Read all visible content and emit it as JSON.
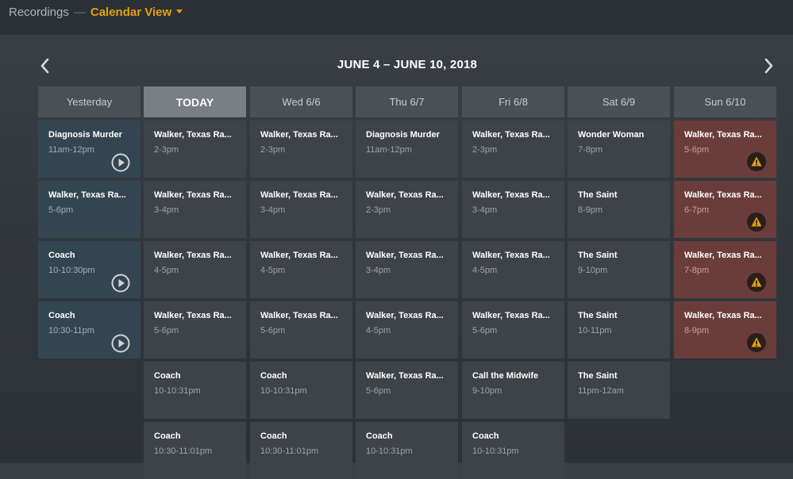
{
  "header": {
    "section": "Recordings",
    "separator": "—",
    "view": "Calendar View"
  },
  "calendar": {
    "range": "JUNE 4 – JUNE 10, 2018",
    "days": [
      {
        "label": "Yesterday",
        "today": false,
        "items": [
          {
            "title": "Diagnosis Murder",
            "time": "11am-12pm",
            "status": "watched",
            "icon": "play-icon"
          },
          {
            "title": "Walker, Texas Ra...",
            "time": "5-6pm",
            "status": "watched",
            "icon": ""
          },
          {
            "title": "Coach",
            "time": "10-10:30pm",
            "status": "watched",
            "icon": "play-icon"
          },
          {
            "title": "Coach",
            "time": "10:30-11pm",
            "status": "watched",
            "icon": "play-icon"
          }
        ]
      },
      {
        "label": "TODAY",
        "today": true,
        "items": [
          {
            "title": "Walker, Texas Ra...",
            "time": "2-3pm",
            "status": "scheduled",
            "icon": ""
          },
          {
            "title": "Walker, Texas Ra...",
            "time": "3-4pm",
            "status": "scheduled",
            "icon": ""
          },
          {
            "title": "Walker, Texas Ra...",
            "time": "4-5pm",
            "status": "scheduled",
            "icon": ""
          },
          {
            "title": "Walker, Texas Ra...",
            "time": "5-6pm",
            "status": "scheduled",
            "icon": ""
          },
          {
            "title": "Coach",
            "time": "10-10:31pm",
            "status": "scheduled",
            "icon": ""
          },
          {
            "title": "Coach",
            "time": "10:30-11:01pm",
            "status": "scheduled",
            "icon": ""
          }
        ]
      },
      {
        "label": "Wed 6/6",
        "today": false,
        "items": [
          {
            "title": "Walker, Texas Ra...",
            "time": "2-3pm",
            "status": "scheduled",
            "icon": ""
          },
          {
            "title": "Walker, Texas Ra...",
            "time": "3-4pm",
            "status": "scheduled",
            "icon": ""
          },
          {
            "title": "Walker, Texas Ra...",
            "time": "4-5pm",
            "status": "scheduled",
            "icon": ""
          },
          {
            "title": "Walker, Texas Ra...",
            "time": "5-6pm",
            "status": "scheduled",
            "icon": ""
          },
          {
            "title": "Coach",
            "time": "10-10:31pm",
            "status": "scheduled",
            "icon": ""
          },
          {
            "title": "Coach",
            "time": "10:30-11:01pm",
            "status": "scheduled",
            "icon": ""
          }
        ]
      },
      {
        "label": "Thu 6/7",
        "today": false,
        "items": [
          {
            "title": "Diagnosis Murder",
            "time": "11am-12pm",
            "status": "scheduled",
            "icon": ""
          },
          {
            "title": "Walker, Texas Ra...",
            "time": "2-3pm",
            "status": "scheduled",
            "icon": ""
          },
          {
            "title": "Walker, Texas Ra...",
            "time": "3-4pm",
            "status": "scheduled",
            "icon": ""
          },
          {
            "title": "Walker, Texas Ra...",
            "time": "4-5pm",
            "status": "scheduled",
            "icon": ""
          },
          {
            "title": "Walker, Texas Ra...",
            "time": "5-6pm",
            "status": "scheduled",
            "icon": ""
          },
          {
            "title": "Coach",
            "time": "10-10:31pm",
            "status": "scheduled",
            "icon": ""
          }
        ]
      },
      {
        "label": "Fri 6/8",
        "today": false,
        "items": [
          {
            "title": "Walker, Texas Ra...",
            "time": "2-3pm",
            "status": "scheduled",
            "icon": ""
          },
          {
            "title": "Walker, Texas Ra...",
            "time": "3-4pm",
            "status": "scheduled",
            "icon": ""
          },
          {
            "title": "Walker, Texas Ra...",
            "time": "4-5pm",
            "status": "scheduled",
            "icon": ""
          },
          {
            "title": "Walker, Texas Ra...",
            "time": "5-6pm",
            "status": "scheduled",
            "icon": ""
          },
          {
            "title": "Call the Midwife",
            "time": "9-10pm",
            "status": "scheduled",
            "icon": ""
          },
          {
            "title": "Coach",
            "time": "10-10:31pm",
            "status": "scheduled",
            "icon": ""
          }
        ]
      },
      {
        "label": "Sat 6/9",
        "today": false,
        "items": [
          {
            "title": "Wonder Woman",
            "time": "7-8pm",
            "status": "scheduled",
            "icon": ""
          },
          {
            "title": "The Saint",
            "time": "8-9pm",
            "status": "scheduled",
            "icon": ""
          },
          {
            "title": "The Saint",
            "time": "9-10pm",
            "status": "scheduled",
            "icon": ""
          },
          {
            "title": "The Saint",
            "time": "10-11pm",
            "status": "scheduled",
            "icon": ""
          },
          {
            "title": "The Saint",
            "time": "11pm-12am",
            "status": "scheduled",
            "icon": ""
          }
        ]
      },
      {
        "label": "Sun 6/10",
        "today": false,
        "items": [
          {
            "title": "Walker, Texas Ra...",
            "time": "5-6pm",
            "status": "conflict",
            "icon": "warning-icon"
          },
          {
            "title": "Walker, Texas Ra...",
            "time": "6-7pm",
            "status": "conflict",
            "icon": "warning-icon"
          },
          {
            "title": "Walker, Texas Ra...",
            "time": "7-8pm",
            "status": "conflict",
            "icon": "warning-icon"
          },
          {
            "title": "Walker, Texas Ra...",
            "time": "8-9pm",
            "status": "conflict",
            "icon": "warning-icon"
          }
        ]
      }
    ]
  },
  "colors": {
    "accent": "#e5a00d",
    "watched": "#344552",
    "conflict": "#6b3d3a",
    "scheduled": "#3e4348"
  }
}
